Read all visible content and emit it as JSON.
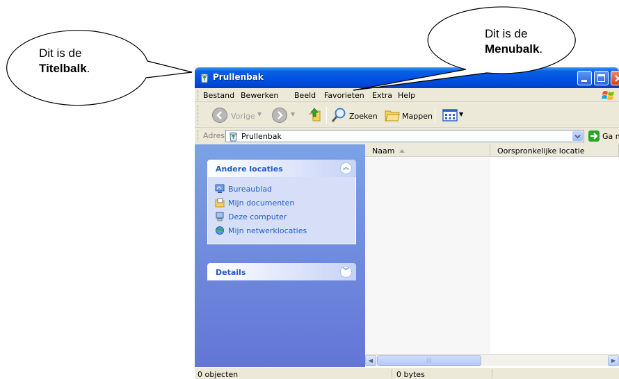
{
  "callouts": {
    "left": {
      "line1": "Dit is de",
      "line2_bold": "Titelbalk",
      "line2_suffix": "."
    },
    "right": {
      "line1": "Dit is de",
      "line2_bold": "Menubalk",
      "line2_suffix": "."
    }
  },
  "window": {
    "title": "Prullenbak",
    "menu": [
      "Bestand",
      "Bewerken",
      "Beeld",
      "Favorieten",
      "Extra",
      "Help"
    ],
    "toolbar": {
      "back": "Vorige",
      "search": "Zoeken",
      "folders": "Mappen"
    },
    "address": {
      "label": "Adres",
      "value": "Prullenbak",
      "go": "Ga naar"
    },
    "taskpane": {
      "other_places": {
        "title": "Andere locaties",
        "links": [
          "Bureaublad",
          "Mijn documenten",
          "Deze computer",
          "Mijn netwerklocaties"
        ]
      },
      "details": {
        "title": "Details"
      }
    },
    "columns": [
      "Naam",
      "Oorspronkelijke locatie"
    ],
    "status": {
      "count": "0 objecten",
      "size": "0 bytes"
    }
  },
  "colors": {
    "titlebar": "#0054e3",
    "taskpane": "#7ba2e7",
    "link": "#215dc6"
  }
}
